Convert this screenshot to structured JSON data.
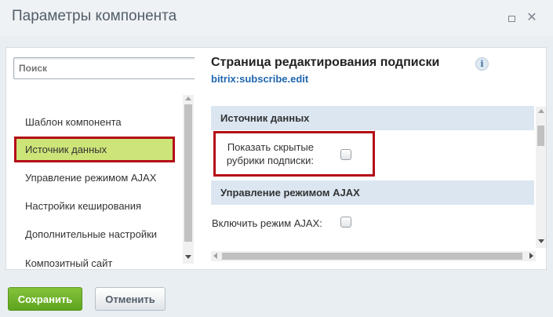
{
  "window": {
    "title": "Параметры компонента"
  },
  "sidebar": {
    "search_placeholder": "Поиск",
    "items": [
      {
        "label": "Шаблон компонента",
        "active": false
      },
      {
        "label": "Источник данных",
        "active": true
      },
      {
        "label": "Управление режимом AJAX",
        "active": false
      },
      {
        "label": "Настройки кеширования",
        "active": false
      },
      {
        "label": "Дополнительные настройки",
        "active": false
      },
      {
        "label": "Композитный сайт",
        "active": false
      }
    ]
  },
  "main": {
    "component_title": "Страница редактирования подписки",
    "component_code": "bitrix:subscribe.edit",
    "info_icon": "i",
    "sections": [
      {
        "title": "Источник данных",
        "fields": [
          {
            "label_line1": "Показать скрытые",
            "label_line2": "рубрики подписки:",
            "checked": false
          }
        ]
      },
      {
        "title": "Управление режимом AJAX",
        "fields": [
          {
            "label": "Включить режим AJAX:",
            "checked": false
          }
        ]
      }
    ]
  },
  "footer": {
    "save_label": "Сохранить",
    "cancel_label": "Отменить"
  },
  "colors": {
    "active_item_bg": "#cde478",
    "highlight_border": "#b40d17",
    "section_bg": "#dbe6f1",
    "link_color": "#2067b0",
    "save_button": "#6db02b"
  },
  "icons": {
    "minimize": "maximize-icon",
    "close": "close-icon",
    "info": "info-icon"
  }
}
